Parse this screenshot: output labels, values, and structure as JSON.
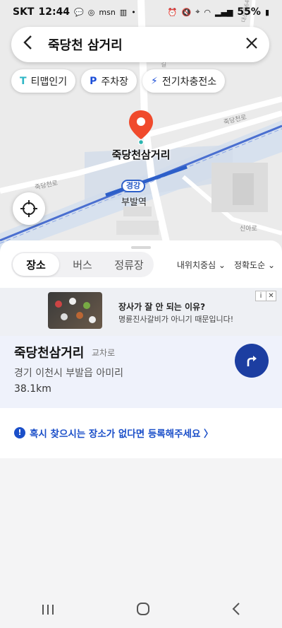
{
  "status_bar": {
    "carrier": "SKT",
    "time": "12:44",
    "battery": "55%",
    "left_icons": [
      "talk-icon",
      "instagram-icon",
      "msn-icon",
      "chart-icon",
      "dot-icon"
    ],
    "right_icons": [
      "alarm-icon",
      "mute-icon",
      "location-icon",
      "wifi-icon",
      "signal-icon",
      "battery-icon"
    ]
  },
  "search": {
    "query": "죽당천 삼거리"
  },
  "chips": [
    {
      "label": "티맵인기",
      "icon": "tmap-icon",
      "glyph": "T"
    },
    {
      "label": "주차장",
      "icon": "parking-icon",
      "glyph": "P"
    },
    {
      "label": "전기차충전소",
      "icon": "lightning-icon",
      "glyph": "⚡"
    }
  ],
  "map": {
    "pin_label": "죽당천삼거리",
    "station_line": "경강",
    "station_name": "부발역",
    "road_labels": [
      "죽당천로",
      "죽당천로",
      "신아로",
      "대산로646번길",
      "길"
    ]
  },
  "sheet": {
    "tabs": [
      {
        "label": "장소",
        "active": true
      },
      {
        "label": "버스",
        "active": false
      },
      {
        "label": "정류장",
        "active": false
      }
    ],
    "sort_options": [
      "내위치중심 ⌄",
      "정확도순 ⌄"
    ],
    "ad": {
      "title": "장사가 잘 안 되는 이유?",
      "subtitle": "명륜진사갈비가 아니기 때문입니다!",
      "info_glyph": "i",
      "close_glyph": "✕"
    },
    "result": {
      "name": "죽당천삼거리",
      "category": "교차로",
      "address": "경기 이천시 부발읍 아미리",
      "distance": "38.1km"
    },
    "register_text": "혹시 찾으시는 장소가 없다면 등록해주세요 〉"
  },
  "colors": {
    "accent_blue": "#1c3ea1",
    "link_blue": "#1b4fc9",
    "pin_red": "#f04a2c",
    "rail_blue": "#2d5fc9"
  }
}
